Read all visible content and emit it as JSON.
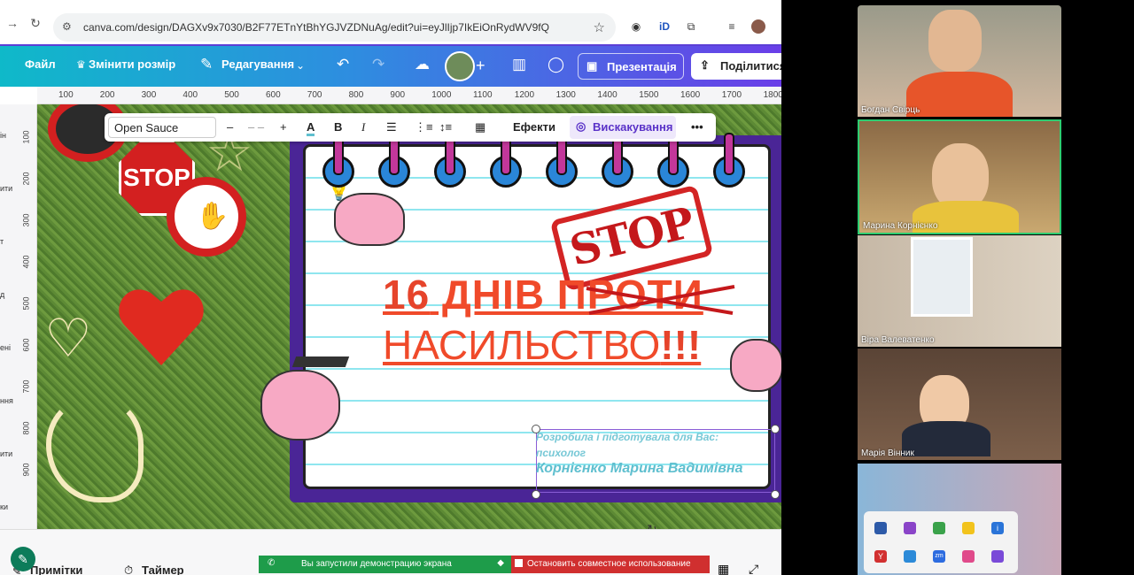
{
  "browser": {
    "url": "canva.com/design/DAGXv9x7030/B2F77ETnYtBhYGJVZDNuAg/edit?ui=eyJlIjp7IkEiOnRydWV9fQ"
  },
  "toolbar": {
    "file": "Файл",
    "resize": "Змінити розмір",
    "edit": "Редагування",
    "present": "Презентація",
    "share": "Поділитися"
  },
  "ruler": {
    "h": [
      "100",
      "200",
      "300",
      "400",
      "500",
      "600",
      "700",
      "800",
      "900",
      "1000",
      "1100",
      "1200",
      "1300",
      "1400",
      "1500",
      "1600",
      "1700",
      "1800"
    ],
    "v": [
      "100",
      "200",
      "300",
      "400",
      "500",
      "600",
      "700",
      "800",
      "900"
    ]
  },
  "side_labels": [
    "ін",
    "ити",
    "т",
    "д",
    "ені",
    "ння",
    "ити",
    "ки"
  ],
  "format": {
    "font": "Open Sauce",
    "minus": "–",
    "size": "– –",
    "plus": "+",
    "bold": "B",
    "italic": "I",
    "effects": "Ефекти",
    "animate": "Вискакування",
    "more": "•••"
  },
  "design": {
    "num": "16",
    "title1_rest": " ДНІВ ПРОТИ",
    "title2": "НАСИЛЬСТВО",
    "bang": "!!!",
    "stamp": "STOP",
    "stop_sign": "STOP",
    "credit_line1": "Розробила і підготувала для Вас:",
    "credit_line2": "психолог",
    "credit_name": "Корнієнко Марина Вадимівна"
  },
  "bottom": {
    "notes": "Примітки",
    "timer": "Таймер",
    "screen_share": "Вы запустили демонстрацию экрана",
    "stop_share": "Остановить совместное использование"
  },
  "participants": [
    {
      "name": "Богдан Свірць"
    },
    {
      "name": "Марина Корнієнко"
    },
    {
      "name": "Віра Валеватенко"
    },
    {
      "name": "Марія Вінник"
    },
    {
      "name": ""
    }
  ]
}
